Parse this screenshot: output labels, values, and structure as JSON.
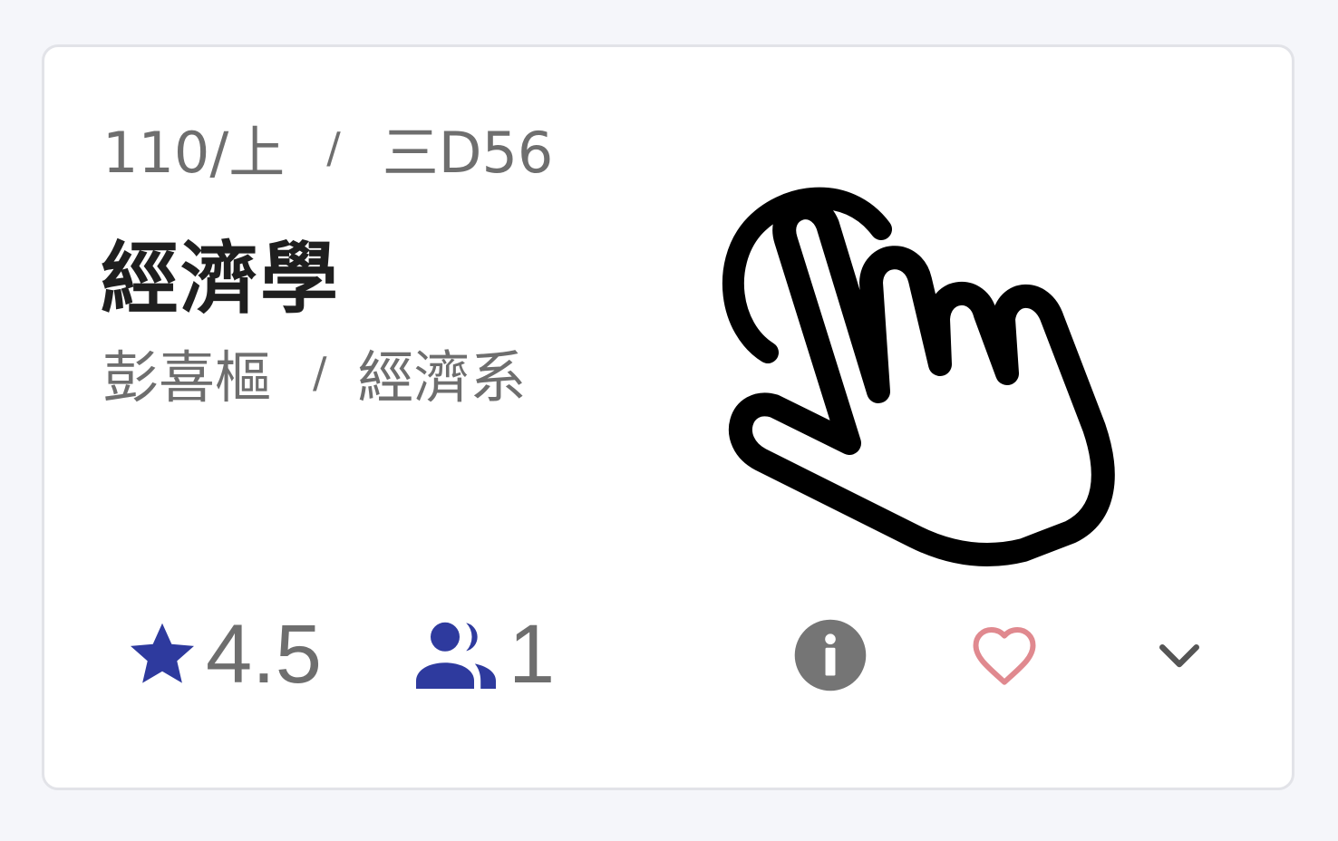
{
  "course": {
    "semester": "110/上",
    "separator": "/",
    "schedule": "三D56",
    "title": "經濟學",
    "teacher": "彭喜樞",
    "department": "經濟系"
  },
  "stats": {
    "rating": "4.5",
    "students": "1"
  },
  "icons": {
    "rating": "star-icon",
    "students": "people-icon",
    "info": "info-icon",
    "favorite": "heart-outline-icon",
    "expand": "chevron-down-icon",
    "pointer": "pointing-hand-cursor-icon"
  },
  "colors": {
    "accent": "#2e3a9e",
    "favorite": "#e0898f",
    "muted_text": "#6e6e6e",
    "title_text": "#1f1f1f"
  }
}
